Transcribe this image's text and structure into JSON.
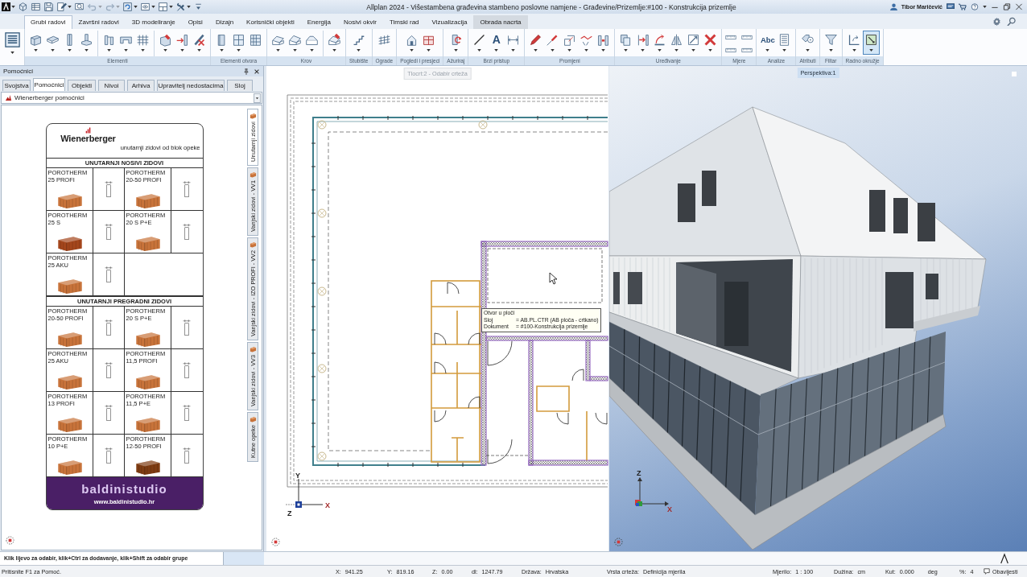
{
  "window": {
    "title": "Allplan 2024 - Višestambena građevina stambeno poslovne namjene - Građevine/Prizemlje:#100 - Konstrukcija prizemlje",
    "user": "Tibor Maričević"
  },
  "app_menu": {
    "dropdown": true
  },
  "quick_access": [
    {
      "dropdown": false,
      "disabled": false
    },
    {
      "dropdown": false,
      "disabled": false
    },
    {
      "dropdown": false,
      "disabled": false
    },
    {
      "dropdown": true,
      "disabled": false
    },
    {
      "dropdown": false,
      "disabled": false
    },
    {
      "dropdown": true,
      "disabled": true
    },
    {
      "dropdown": true,
      "disabled": true
    },
    {
      "dropdown": true,
      "disabled": false
    },
    {
      "dropdown": true,
      "disabled": false
    },
    {
      "dropdown": true,
      "disabled": false
    },
    {
      "dropdown": true,
      "disabled": false
    },
    {
      "dropdown": false,
      "disabled": false
    }
  ],
  "ribbon": {
    "tabs": [
      {
        "label": "Grubi radovi",
        "selected": true,
        "contextual": false
      },
      {
        "label": "Završni radovi",
        "selected": false,
        "contextual": false
      },
      {
        "label": "3D modeliranje",
        "selected": false,
        "contextual": false
      },
      {
        "label": "Opisi",
        "selected": false,
        "contextual": false
      },
      {
        "label": "Dizajn",
        "selected": false,
        "contextual": false
      },
      {
        "label": "Korisnički objekti",
        "selected": false,
        "contextual": false
      },
      {
        "label": "Energija",
        "selected": false,
        "contextual": false
      },
      {
        "label": "Nosivi okvir",
        "selected": false,
        "contextual": false
      },
      {
        "label": "Timski rad",
        "selected": false,
        "contextual": false
      },
      {
        "label": "Vizualizacija",
        "selected": false,
        "contextual": false
      },
      {
        "label": "Obrada nacrta",
        "selected": false,
        "contextual": true
      }
    ],
    "palette_button": {
      "dropdown": true
    },
    "groups": [
      {
        "label": "Elementi",
        "kind": "large",
        "clusters": [
          [
            {
              "dropdown": true,
              "on": false
            },
            {
              "dropdown": true,
              "on": false
            },
            {
              "dropdown": true,
              "on": false
            },
            {
              "dropdown": true,
              "on": false
            }
          ],
          [
            {
              "dropdown": true,
              "on": false
            },
            {
              "dropdown": true,
              "on": false
            },
            {
              "dropdown": true,
              "on": false
            }
          ],
          [
            {
              "dropdown": true,
              "on": false
            },
            {
              "dropdown": true,
              "on": false
            },
            {
              "dropdown": true,
              "on": false
            }
          ]
        ]
      },
      {
        "label": "Elementi otvora",
        "kind": "large",
        "clusters": [
          [
            {
              "dropdown": true,
              "on": false
            },
            {
              "dropdown": true,
              "on": false
            },
            {
              "dropdown": false,
              "on": false
            }
          ]
        ]
      },
      {
        "label": "Krov",
        "kind": "large",
        "clusters": [
          [
            {
              "dropdown": true,
              "on": false
            },
            {
              "dropdown": true,
              "on": false
            },
            {
              "dropdown": true,
              "on": false
            }
          ],
          [
            {
              "dropdown": true,
              "on": false
            }
          ]
        ]
      },
      {
        "label": "Stubište",
        "kind": "large",
        "clusters": [
          [
            {
              "dropdown": true,
              "on": false
            }
          ]
        ]
      },
      {
        "label": "Ograde",
        "kind": "large",
        "clusters": [
          [
            {
              "dropdown": false,
              "on": false
            }
          ]
        ]
      },
      {
        "label": "Pogledi i presjeci",
        "kind": "large",
        "clusters": [
          [
            {
              "dropdown": true,
              "on": false
            },
            {
              "dropdown": true,
              "on": false
            }
          ]
        ]
      },
      {
        "label": "Ažuriraj",
        "kind": "large",
        "clusters": [
          [
            {
              "dropdown": true,
              "on": false
            }
          ]
        ]
      },
      {
        "label": "Brzi pristup",
        "kind": "large",
        "clusters": [
          [
            {
              "dropdown": true,
              "on": false
            },
            {
              "glyph": "A",
              "dropdown": true,
              "on": false
            },
            {
              "dropdown": true,
              "on": false
            }
          ]
        ]
      },
      {
        "label": "Promjeni",
        "kind": "large",
        "clusters": [
          [
            {
              "dropdown": true,
              "on": false
            },
            {
              "dropdown": true,
              "on": false
            },
            {
              "dropdown": true,
              "on": false
            },
            {
              "dropdown": true,
              "on": false
            },
            {
              "dropdown": true,
              "on": false
            }
          ]
        ]
      },
      {
        "label": "Uređivanje",
        "kind": "large",
        "clusters": [
          [
            {
              "dropdown": true,
              "on": false
            },
            {
              "dropdown": true,
              "on": false
            },
            {
              "dropdown": true,
              "on": false
            },
            {
              "dropdown": true,
              "on": false
            },
            {
              "dropdown": true,
              "on": false
            },
            {
              "dropdown": true,
              "on": false
            }
          ]
        ]
      },
      {
        "label": "Mjere",
        "kind": "small",
        "clusters": [
          [
            {
              "dropdown": false,
              "on": false
            },
            {
              "dropdown": false,
              "on": false
            },
            {
              "dropdown": false,
              "on": false
            },
            {
              "dropdown": false,
              "on": false
            }
          ]
        ]
      },
      {
        "label": "Analize",
        "kind": "large",
        "clusters": [
          [
            {
              "glyph": "Abc",
              "dropdown": true,
              "on": false
            },
            {
              "dropdown": true,
              "on": false
            }
          ]
        ]
      },
      {
        "label": "Atributi",
        "kind": "large",
        "clusters": [
          [
            {
              "dropdown": true,
              "on": false
            }
          ]
        ]
      },
      {
        "label": "Filtar",
        "kind": "large",
        "clusters": [
          [
            {
              "dropdown": true,
              "on": false
            }
          ]
        ]
      },
      {
        "label": "Radno okružje",
        "kind": "large",
        "clusters": [
          [
            {
              "dropdown": true,
              "on": false
            },
            {
              "dropdown": true,
              "on": true
            }
          ]
        ]
      }
    ]
  },
  "helpers_panel": {
    "title": "Pomoćnici",
    "tabs": [
      {
        "label": "Svojstva",
        "selected": false
      },
      {
        "label": "Pomoćnici",
        "selected": true
      },
      {
        "label": "Objekti",
        "selected": false
      },
      {
        "label": "Nivoi",
        "selected": false
      },
      {
        "label": "Arhiva",
        "selected": false
      },
      {
        "label": "Upravitelj nedostacima",
        "selected": false
      },
      {
        "label": "Sloj",
        "selected": false
      }
    ],
    "dropdown": {
      "value": "Wienerberger pomoćnici"
    },
    "card": {
      "brand": "Wienerberger",
      "subtitle": "unutarnji zidovi od blok opeke",
      "sections": [
        {
          "title": "UNUTARNJI NOSIVI ZIDOVI",
          "products": [
            {
              "name": "POROTHERM 25 PROFI",
              "color": "#c8733a"
            },
            {
              "name": "POROTHERM 20-50 PROFI",
              "color": "#c8733a"
            },
            {
              "name": "POROTHERM 25 S",
              "color": "#a4461c"
            },
            {
              "name": "POROTHERM 20 S P+E",
              "color": "#c8733a"
            },
            {
              "name": "POROTHERM 25 AKU",
              "color": "#c8733a"
            }
          ]
        },
        {
          "title": "UNUTARNJI PREGRADNI ZIDOVI",
          "products": [
            {
              "name": "POROTHERM 20-50 PROFI",
              "color": "#c8733a"
            },
            {
              "name": "POROTHERM 20 S P+E",
              "color": "#c8733a"
            },
            {
              "name": "POROTHERM 25 AKU",
              "color": "#c8733a"
            },
            {
              "name": "POROTHERM 11,5 PROFI",
              "color": "#c8733a"
            },
            {
              "name": "POROTHERM 13 PROFI",
              "color": "#c8733a"
            },
            {
              "name": "POROTHERM 11,5 P+E",
              "color": "#c8733a"
            },
            {
              "name": "POROTHERM 10 P+E",
              "color": "#c8733a"
            },
            {
              "name": "POROTHERM 12-50 PROFI",
              "color": "#7e3c12"
            }
          ]
        }
      ],
      "footer": {
        "logo": "baldinistudio",
        "url": "www.baldinistudio.hr"
      }
    },
    "side_tabs": [
      {
        "label": "Unutarnji zidovi",
        "selected": true
      },
      {
        "label": "Vanjski zidovi - VV1",
        "selected": false
      },
      {
        "label": "Vanjski zidovi - IZO PROFI - VV2",
        "selected": false
      },
      {
        "label": "Vanjski zidovi - VV3",
        "selected": false
      },
      {
        "label": "Kutne opeke",
        "selected": false
      }
    ]
  },
  "plan_view": {
    "label": "Tlocrt:2 - Odabir crteža",
    "tooltip": {
      "title": "Otvor u ploči",
      "rows": [
        {
          "key": "Sloj",
          "value": "= AB.PL.CTR (AB ploča - crtkano)"
        },
        {
          "key": "Dokument",
          "value": "= #100-Konstrukcija prizemlje"
        }
      ]
    },
    "axes": {
      "y": "Y",
      "x": "X",
      "z": "Z"
    }
  },
  "perspective_view": {
    "label": "Perspektiva:1",
    "axes": {
      "z": "Z",
      "x": "X"
    }
  },
  "prompt": {
    "text": "Klik lijevo za odabir, klik+Ctrl za dodavanje, klik+Shift za odabir grupe"
  },
  "status_bar": {
    "hint": "Pritisnite F1 za Pomoć.",
    "fields": [
      {
        "label": "X:",
        "value": "941.25"
      },
      {
        "label": "Y:",
        "value": "819.16"
      },
      {
        "label": "Z:",
        "value": "0.00"
      },
      {
        "label": "dl:",
        "value": "1247.79"
      },
      {
        "label": "Država:",
        "value": "Hrvatska"
      },
      {
        "label": "Vrsta crteža:",
        "value": "Definicija mjerila"
      },
      {
        "label": "Mjerilo:",
        "value": "1 : 100"
      },
      {
        "label": "Dužina:",
        "value": "cm"
      },
      {
        "label": "Kut:",
        "value": "0.000",
        "unit": "deg"
      },
      {
        "label": "%:",
        "value": "4"
      }
    ],
    "notifications": "Obavijesti"
  }
}
